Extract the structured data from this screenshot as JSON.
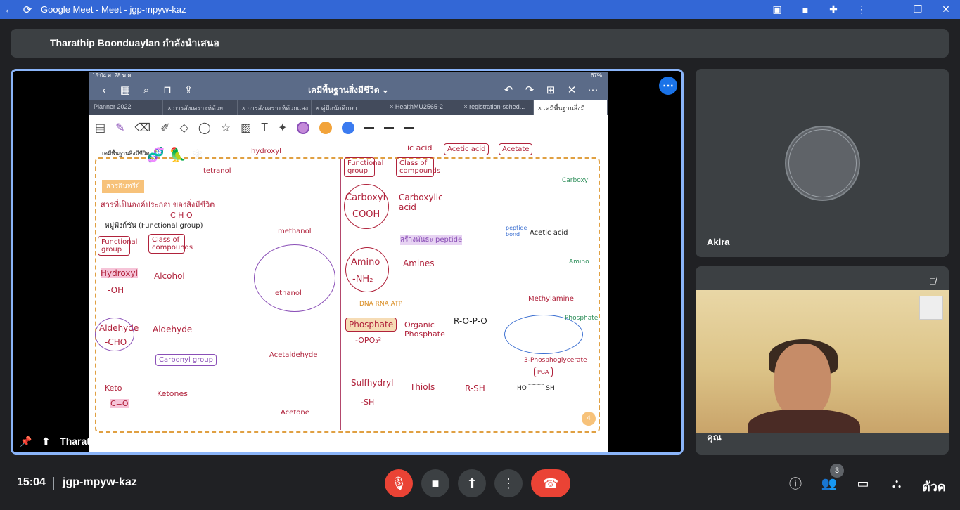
{
  "window": {
    "title": "Google Meet - Meet - jgp-mpyw-kaz",
    "back_icon": "←",
    "reload_icon": "⟳"
  },
  "banner": {
    "text": "Tharathip Boonduaylan กำลังนำเสนอ"
  },
  "slide": {
    "status_time": "15:04  ส. 28 พ.ค.",
    "status_battery": "67%",
    "doc_title": "เคมีพื้นฐานสิ่งมีชีวิต ⌄",
    "tabs": [
      "Planner 2022",
      "× การสังเคราะห์ด้วย...",
      "× การสังเคราะห์ด้วยแสง",
      "× คู่มือนักศึกษา",
      "× HealthMU2565-2",
      "× registration-sched...",
      "× เคมีพื้นฐานสิ่งมี..."
    ],
    "notes": {
      "header_label": "เคมีพื้นฐานสิ่งมีชีวิต",
      "section": "สารอินทรีย์",
      "line1": "สารที่เป็นองค์ประกอบของสิ่งมีชีวิต",
      "line2": "C  H  O",
      "line3": "หมู่ฟังก์ชัน (Functional group)",
      "tetranol": "tetranol",
      "hydroxyl_top": "hydroxyl",
      "functional_group": "Functional group",
      "class_of_compounds": "Class of compounds",
      "methanol": "methanol",
      "ethanol": "ethanol",
      "hydroxyl": "Hydroxyl",
      "oh": "-OH",
      "alcohol": "Alcohol",
      "aldehyde": "Aldehyde",
      "cho": "-CHO",
      "aldehyde2": "Aldehyde",
      "acetaldehyde": "Acetaldehyde",
      "carbonyl_group": "Carbonyl group",
      "keto": "Keto",
      "co": "C=O",
      "ketones": "Ketones",
      "acetone": "Acetone",
      "carboxyl": "Carboxyl",
      "cooh": "COOH",
      "carboxylic_acid": "Carboxylic acid",
      "ic_acid": "ic acid",
      "acetic_acid": "Acetic acid",
      "acetate": "Acetate",
      "peptide": "สร้างพันธะ peptide",
      "peptide_bond": "peptide bond",
      "acetic_acid2": "Acetic acid",
      "amino": "Amino",
      "nh2": "-NH₂",
      "amines": "Amines",
      "methylamine": "Methylamine",
      "amino_tag": "Amino",
      "carboxyl_tag": "Carboxyl",
      "dna_rna_atp": "DNA RNA ATP",
      "phosphate": "Phosphate",
      "opo3": "-OPO₃²⁻",
      "organic_phosphate": "Organic Phosphate",
      "rop": "R-O-P-O⁻",
      "phosphate_tag": "Phosphate",
      "pga": "3-Phosphoglycerate",
      "pga_short": "PGA",
      "sulfhydryl": "Sulfhydryl",
      "sh": "-SH",
      "thiols": "Thiols",
      "rsh": "R-SH",
      "ho_sh": "HO ⁀⁀⁀ SH",
      "page_num": "4"
    }
  },
  "presenter_label": "Tharathip Boonduaylan",
  "tiles": {
    "akira": "Akira",
    "self": "คุณ"
  },
  "bottom": {
    "time": "15:04",
    "meeting_code": "jgp-mpyw-kaz",
    "participants_count": "3",
    "broken_image_alt": "ตัวค"
  },
  "colors": {
    "titlebar": "#3367d6",
    "accent_border": "#8ab4f8",
    "end_call": "#ea4335",
    "background": "#202124"
  }
}
